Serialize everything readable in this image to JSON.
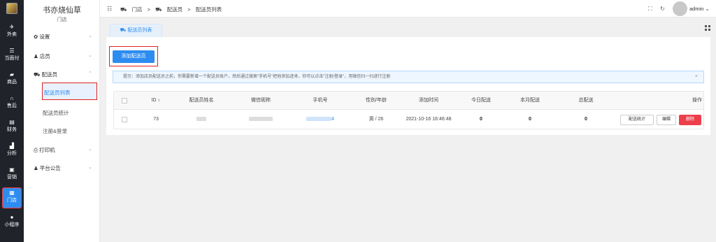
{
  "rail": {
    "items": [
      {
        "label": "外卖",
        "icon": "rocket-icon"
      },
      {
        "label": "当面付",
        "icon": "list-icon"
      },
      {
        "label": "商品",
        "icon": "bag-icon"
      },
      {
        "label": "售后",
        "icon": "headset-icon"
      },
      {
        "label": "财务",
        "icon": "book-icon"
      },
      {
        "label": "分析",
        "icon": "chart-icon"
      },
      {
        "label": "营销",
        "icon": "gift-icon"
      },
      {
        "label": "门店",
        "icon": "store-icon"
      },
      {
        "label": "小程序",
        "icon": "wechat-icon"
      }
    ]
  },
  "sidebar": {
    "shop_name": "书亦烧仙草",
    "shop_sub": "门店",
    "groups": [
      "设置",
      "店员",
      "配送员",
      "打印机",
      "平台公告"
    ],
    "sub_items": [
      "配送员列表",
      "配送员统计",
      "注册&登录"
    ]
  },
  "header": {
    "breadcrumb": [
      "门店",
      ">",
      "配送员",
      ">",
      "配送员列表"
    ],
    "user": "admin"
  },
  "tab": {
    "label": "配送员列表"
  },
  "toolbar": {
    "add_label": "添加配送员"
  },
  "tip": {
    "text": "提示：添加店员配送员之前，你需要新增一个配送员账户，然后通过搜索\"手机号\"把他添加进来，你可以点击\"注册/登录\"，用微信扫一扫进行注册"
  },
  "table": {
    "headers": [
      "ID",
      "配送员姓名",
      "微信昵称",
      "手机号",
      "性别/年龄",
      "添加时间",
      "今日配送",
      "本月配送",
      "总配送",
      "操作"
    ],
    "rows": [
      {
        "id": "73",
        "name": "",
        "nickname": "",
        "phone": "4",
        "gender_age": "男 / 26",
        "added": "2021-10-16 16:46:48",
        "today": "0",
        "month": "0",
        "total": "0"
      }
    ],
    "actions": [
      "配送统计",
      "编辑",
      "删除"
    ]
  },
  "colors": {
    "accent": "#2d8cf0",
    "danger": "#ed3f4b",
    "rail": "#20232a"
  }
}
